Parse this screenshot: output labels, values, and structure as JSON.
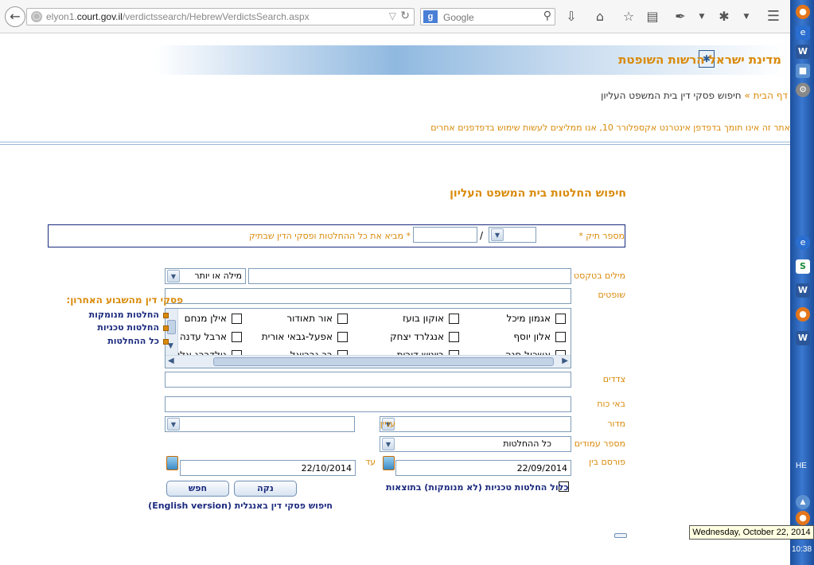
{
  "browser": {
    "url_prefix": "elyon1.",
    "url_domain": "court.gov.il",
    "url_path": "/verdictssearch/HebrewVerdictsSearch.aspx",
    "search_engine_placeholder": "Google"
  },
  "banner": {
    "title": "מדינת ישראל הרשות השופטת"
  },
  "breadcrumb": {
    "home": "דף הבית",
    "separator": "»",
    "current": "חיפוש פסקי דין בית המשפט העליון"
  },
  "notice": "אתר זה אינו תומך בדפדפן אינטרנט אקספלורר 10, אנו ממליצים לעשות שימוש בדפדפנים אחרים",
  "page_title": "חיפוש החלטות בית המשפט העליון",
  "case_number": {
    "label": "מספר תיק *",
    "slash": "/",
    "hint": "* מביא את כל ההחלטות ופסקי הדין שבתיק"
  },
  "fields": {
    "words_label": "מילים בטקסט",
    "words_mode": "מילה או יותר",
    "judges_label": "שופטים",
    "parties_label": "צדדים",
    "attorneys_label": "באי כוח",
    "section_label": "מדור",
    "subject_label": "עניין",
    "pages_label": "מספר עמודים",
    "pages_value": "כל ההחלטות",
    "published_label": "פורסם בין",
    "date_from": "22/09/2014",
    "until_label": "עד",
    "date_to": "22/10/2014"
  },
  "judges": [
    [
      "אגמון מיכל",
      "אוקון בועז",
      "אור תאודור",
      "אילן מנחם"
    ],
    [
      "אלון יוסף",
      "אנגלרד יצחק",
      "אפעל-גבאי אורית",
      "ארבל עדנה"
    ],
    [
      "אשכול חנה",
      "בייניש דורית",
      "בך גבריאל",
      "גולדברג אליהו"
    ]
  ],
  "sidebar_links": {
    "last_week_title": "פסקי דין מהשבוע האחרון:",
    "reasoned": "החלטות מנומקות",
    "technical": "החלטות טכניות",
    "all": "כל ההחלטות"
  },
  "options": {
    "include_technical": "כלול החלטות טכניות (לא מנומקות) בתוצאות"
  },
  "buttons": {
    "clear": "נקה",
    "search": "חפש"
  },
  "english_link": "חיפוש פסקי דין באנגלית (English version)",
  "taskbar": {
    "language": "HE",
    "clock": "10:38",
    "tooltip": "Wednesday, October 22, 2014"
  }
}
